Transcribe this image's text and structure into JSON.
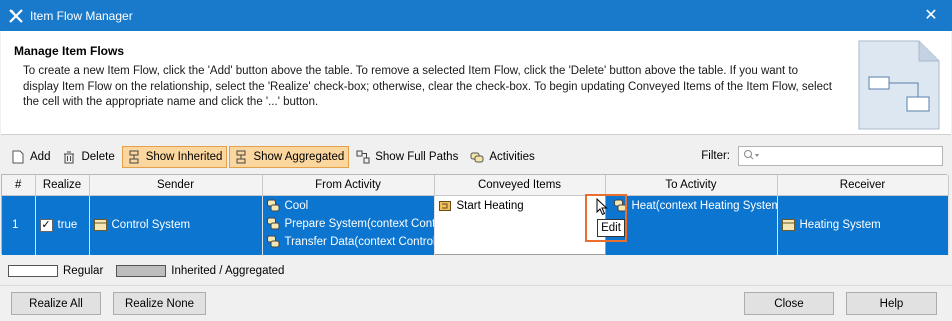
{
  "window": {
    "title": "Item Flow Manager"
  },
  "header": {
    "title": "Manage Item Flows",
    "description": "To create a new Item Flow, click the 'Add' button above the table. To remove a selected Item Flow, click the 'Delete' button above the table. If you want to display Item Flow on the relationship, select the 'Realize' check-box; otherwise, clear the check-box. To begin updating Conveyed Items of the Item Flow, select the cell with the appropriate name and click the '...' button."
  },
  "toolbar": {
    "add": "Add",
    "delete": "Delete",
    "show_inherited": "Show Inherited",
    "show_aggregated": "Show Aggregated",
    "show_full_paths": "Show Full Paths",
    "activities": "Activities",
    "filter_label": "Filter:",
    "filter_value": ""
  },
  "table": {
    "columns": [
      "#",
      "Realize",
      "Sender",
      "From Activity",
      "Conveyed Items",
      "To Activity",
      "Receiver"
    ],
    "rows": [
      {
        "index": "1",
        "realize": "true",
        "realize_checked": true,
        "sender": "Control System",
        "from_activity": [
          "Cool",
          "Prepare System(context Contro",
          "Transfer Data(context Control"
        ],
        "conveyed_items": [
          "Start Heating"
        ],
        "to_activity": "Heat(context Heating System)",
        "receiver": "Heating System"
      }
    ]
  },
  "tooltip": {
    "text": "Edit"
  },
  "legend": {
    "regular": "Regular",
    "inherited": "Inherited / Aggregated"
  },
  "buttons": {
    "realize_all": "Realize All",
    "realize_none": "Realize None",
    "close": "Close",
    "help": "Help"
  },
  "colors": {
    "title_bar": "#1979ca",
    "selection": "#0b75d0",
    "toggle": "#fbd79f",
    "highlight": "#e96f2f"
  }
}
